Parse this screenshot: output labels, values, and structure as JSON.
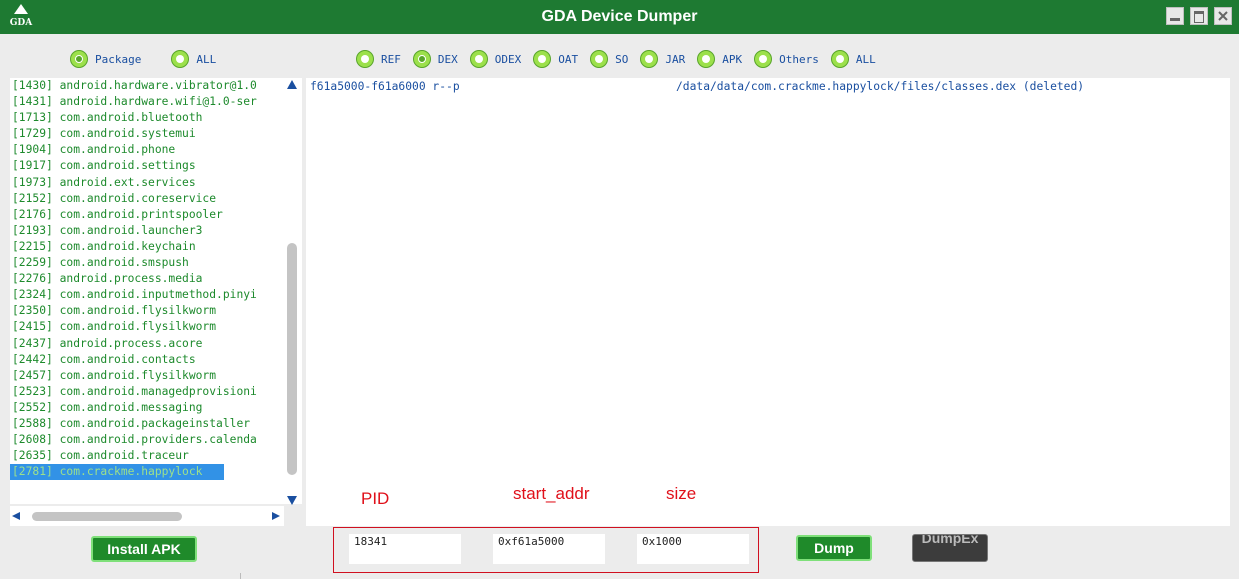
{
  "window": {
    "title": "GDA Device Dumper",
    "logo_text": "GDA"
  },
  "left_filters": [
    {
      "label": "Package",
      "selected": true
    },
    {
      "label": "ALL",
      "selected": false
    }
  ],
  "type_filters": [
    {
      "label": "REF",
      "selected": false
    },
    {
      "label": "DEX",
      "selected": true
    },
    {
      "label": "ODEX",
      "selected": false
    },
    {
      "label": "OAT",
      "selected": false
    },
    {
      "label": "SO",
      "selected": false
    },
    {
      "label": "JAR",
      "selected": false
    },
    {
      "label": "APK",
      "selected": false
    },
    {
      "label": "Others",
      "selected": false
    },
    {
      "label": "ALL",
      "selected": false
    }
  ],
  "processes": [
    "[1430] android.hardware.vibrator@1.0",
    "[1431] android.hardware.wifi@1.0-ser",
    "[1713] com.android.bluetooth",
    "[1729] com.android.systemui",
    "[1904] com.android.phone",
    "[1917] com.android.settings",
    "[1973] android.ext.services",
    "[2152] com.android.coreservice",
    "[2176] com.android.printspooler",
    "[2193] com.android.launcher3",
    "[2215] com.android.keychain",
    "[2259] com.android.smspush",
    "[2276] android.process.media",
    "[2324] com.android.inputmethod.pinyi",
    "[2350] com.android.flysilkworm",
    "[2415] com.android.flysilkworm",
    "[2437] android.process.acore",
    "[2442] com.android.contacts",
    "[2457] com.android.flysilkworm",
    "[2523] com.android.managedprovisioni",
    "[2552] com.android.messaging",
    "[2588] com.android.packageinstaller",
    "[2608] com.android.providers.calenda",
    "[2635] com.android.traceur",
    "[2781] com.crackme.happylock"
  ],
  "selected_process_index": 24,
  "memory_map": {
    "range": "f61a5000-f61a6000 r--p",
    "path": "/data/data/com.crackme.happylock/files/classes.dex (deleted)"
  },
  "annotations": {
    "pid": "PID",
    "start_addr": "start_addr",
    "size": "size"
  },
  "fields": {
    "pid": "18341",
    "start_addr": "0xf61a5000",
    "size": "0x1000"
  },
  "buttons": {
    "install_apk": "Install APK",
    "dump": "Dump",
    "dumpex": "DumpEx"
  },
  "colors": {
    "titlebar": "#1e7a32",
    "accent_green": "#1f8a2a",
    "process_text": "#1d8a2c",
    "selection": "#3292e6",
    "annotation_red": "#e0101a"
  }
}
